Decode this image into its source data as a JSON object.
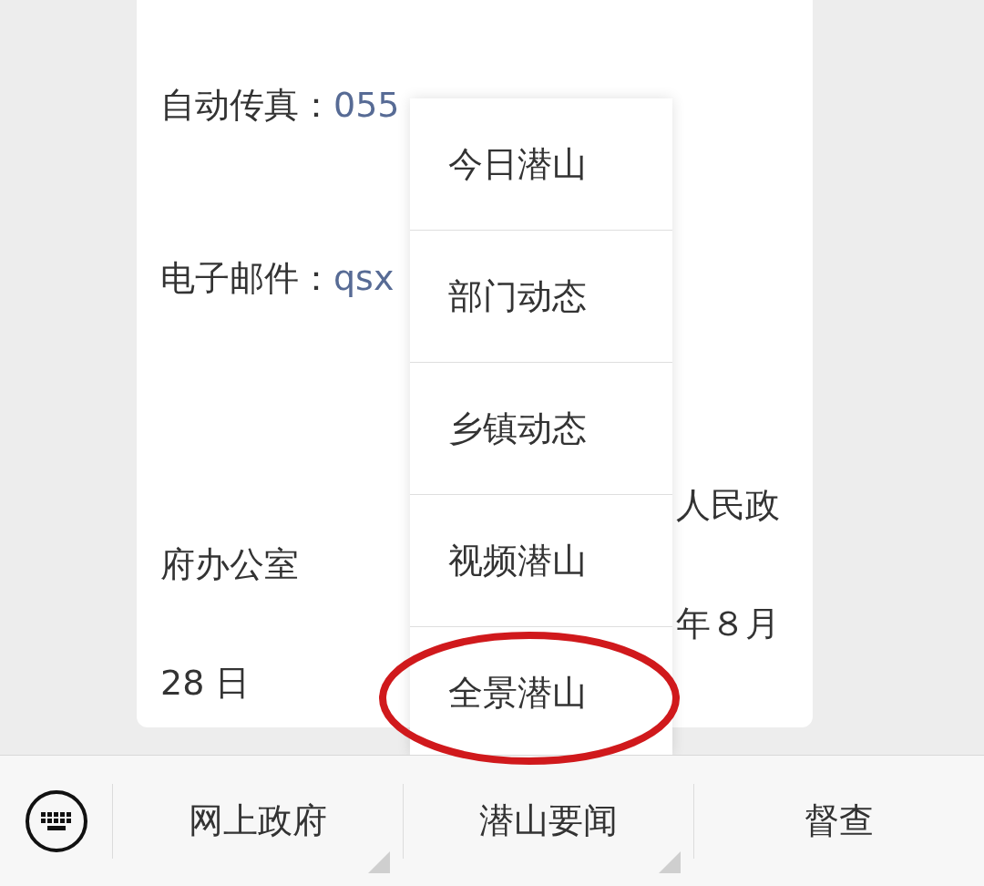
{
  "article": {
    "lines": [
      {
        "kind": "field",
        "label": "自动传真：",
        "value": "055"
      },
      {
        "kind": "field",
        "label": "电子邮件：",
        "value": "qsx"
      },
      {
        "kind": "right",
        "text": "人民政"
      },
      {
        "kind": "left",
        "text": "府办公室"
      },
      {
        "kind": "right",
        "text": "年８月"
      },
      {
        "kind": "left",
        "text": "28 日"
      }
    ]
  },
  "popup_menu": {
    "items": [
      {
        "label": "今日潜山",
        "circled": false
      },
      {
        "label": "部门动态",
        "circled": false
      },
      {
        "label": "乡镇动态",
        "circled": false
      },
      {
        "label": "视频潜山",
        "circled": false
      },
      {
        "label": "全景潜山",
        "circled": true
      }
    ]
  },
  "bottom_menu": {
    "items": [
      {
        "label": "网上政府",
        "has_submenu": true
      },
      {
        "label": "潜山要闻",
        "has_submenu": true
      },
      {
        "label": "督查",
        "has_submenu": false
      }
    ]
  }
}
